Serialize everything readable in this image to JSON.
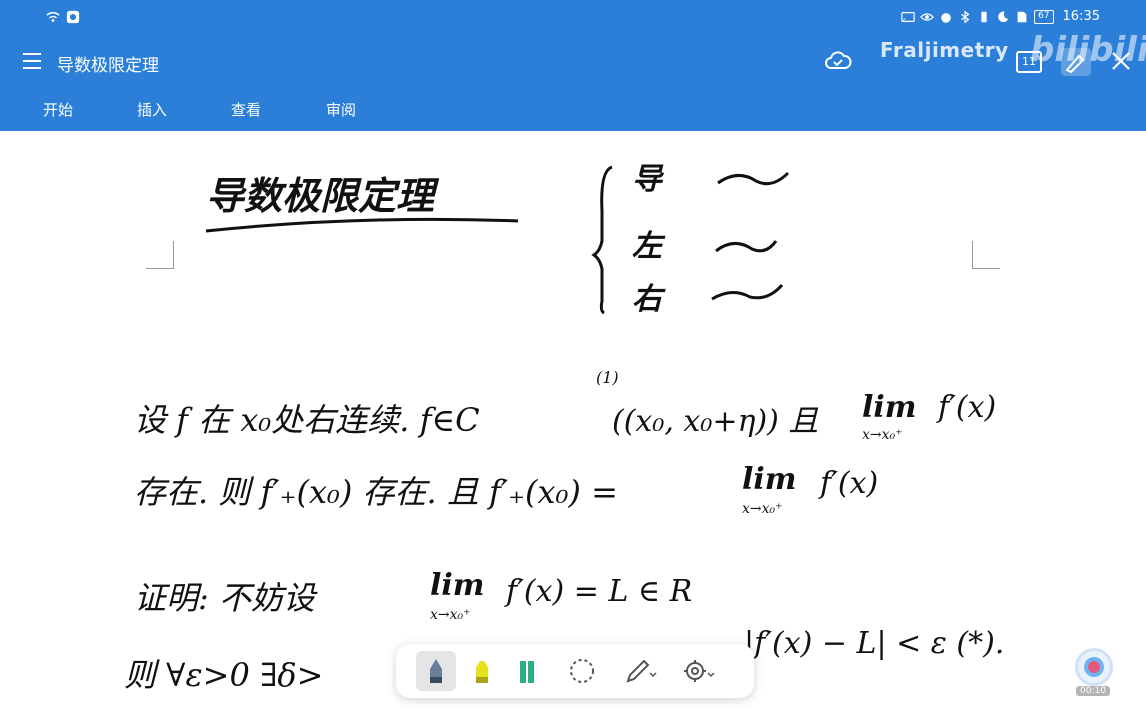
{
  "statusbar": {
    "time": "16:35",
    "battery": "67"
  },
  "titlebar": {
    "title": "导数极限定理",
    "watermark": "Fraljimetry",
    "bili_mark": "bilibili",
    "pages_count": "11"
  },
  "tabs": [
    "开始",
    "插入",
    "查看",
    "审阅"
  ],
  "handwriting": {
    "heading": "导数极限定理",
    "brace_items": [
      "导",
      "左",
      "右"
    ],
    "line1_a": "设 f 在 x₀处右连续. f∈C",
    "line1_sup": "(1)",
    "line1_b": "((x₀, x₀+η)) 且",
    "lim": "lim",
    "lim_sub": "x→x₀⁺",
    "fx": "f′(x)",
    "line2_a": "存在. 则 f′₊(x₀) 存在. 且 f′₊(x₀) =",
    "line3_a": "证明: 不妨设",
    "line3_b": "f′(x) = L ∈ R",
    "line4_a": "则 ∀ε>0 ∃δ>",
    "line4_b": "|f′(x) − L| < ε  (*)."
  },
  "float": {
    "time": "00:10"
  },
  "colors": {
    "accent": "#2b7fd9",
    "highlighter": "#e8e21a",
    "green_marker": "#2fae7e"
  }
}
